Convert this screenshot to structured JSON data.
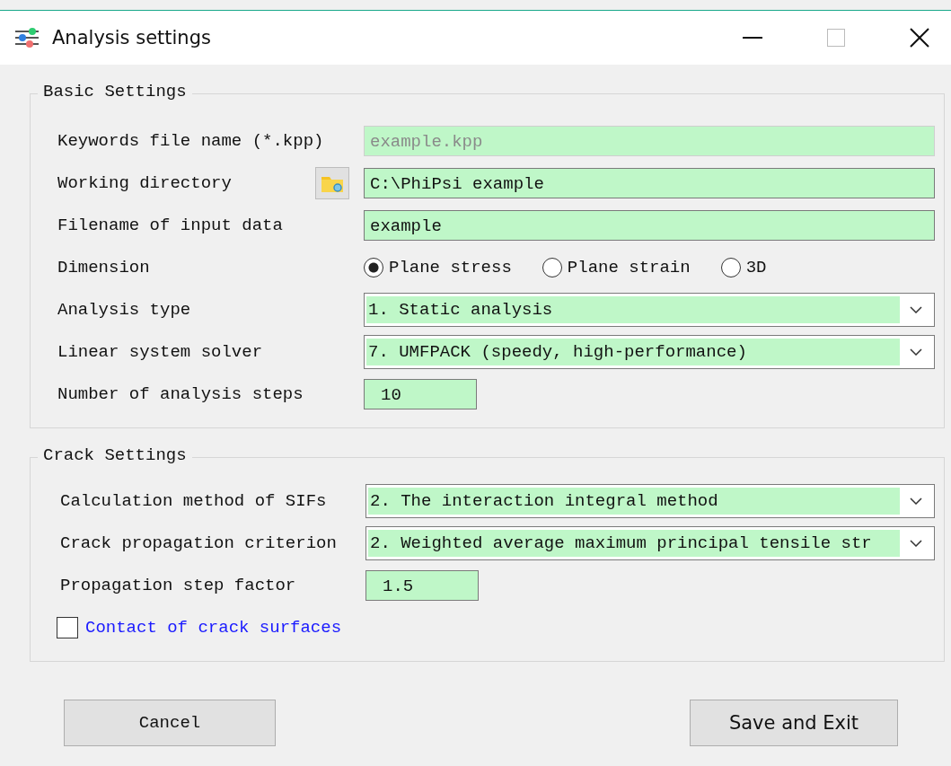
{
  "window": {
    "title": "Analysis settings"
  },
  "groups": [
    {
      "title": "Basic Settings",
      "rows": [
        {
          "kind": "text",
          "label": "Keywords file name (*.kpp)",
          "value": "example.kpp",
          "disabled": true
        },
        {
          "kind": "folder",
          "label": "Working directory",
          "value": "C:\\PhiPsi example",
          "disabled": false
        },
        {
          "kind": "text",
          "label": "Filename of input data",
          "value": "example",
          "disabled": false
        },
        {
          "kind": "radio",
          "label": "Dimension",
          "options": [
            {
              "label": "Plane stress",
              "selected": true
            },
            {
              "label": "Plane strain",
              "selected": false
            },
            {
              "label": "3D",
              "selected": false
            }
          ]
        },
        {
          "kind": "select",
          "label": "Analysis type",
          "value": "1. Static analysis"
        },
        {
          "kind": "select",
          "label": "Linear system solver",
          "value": "7. UMFPACK (speedy, high-performance)"
        },
        {
          "kind": "short",
          "label": "Number of analysis steps",
          "value": "10"
        }
      ]
    },
    {
      "title": "Crack Settings",
      "rows": [
        {
          "kind": "select",
          "label": "Calculation method of SIFs",
          "value": "2. The interaction integral method"
        },
        {
          "kind": "select",
          "label": "Crack propagation criterion",
          "value": "2. Weighted average maximum principal tensile str"
        },
        {
          "kind": "short",
          "label": "Propagation step factor",
          "value": "1.5"
        },
        {
          "kind": "checkbox",
          "label": "Contact of crack surfaces",
          "checked": false
        }
      ]
    }
  ],
  "buttons": [
    {
      "label": "Cancel",
      "kind": "mono"
    },
    {
      "label": "Save and Exit",
      "kind": "sans"
    }
  ]
}
